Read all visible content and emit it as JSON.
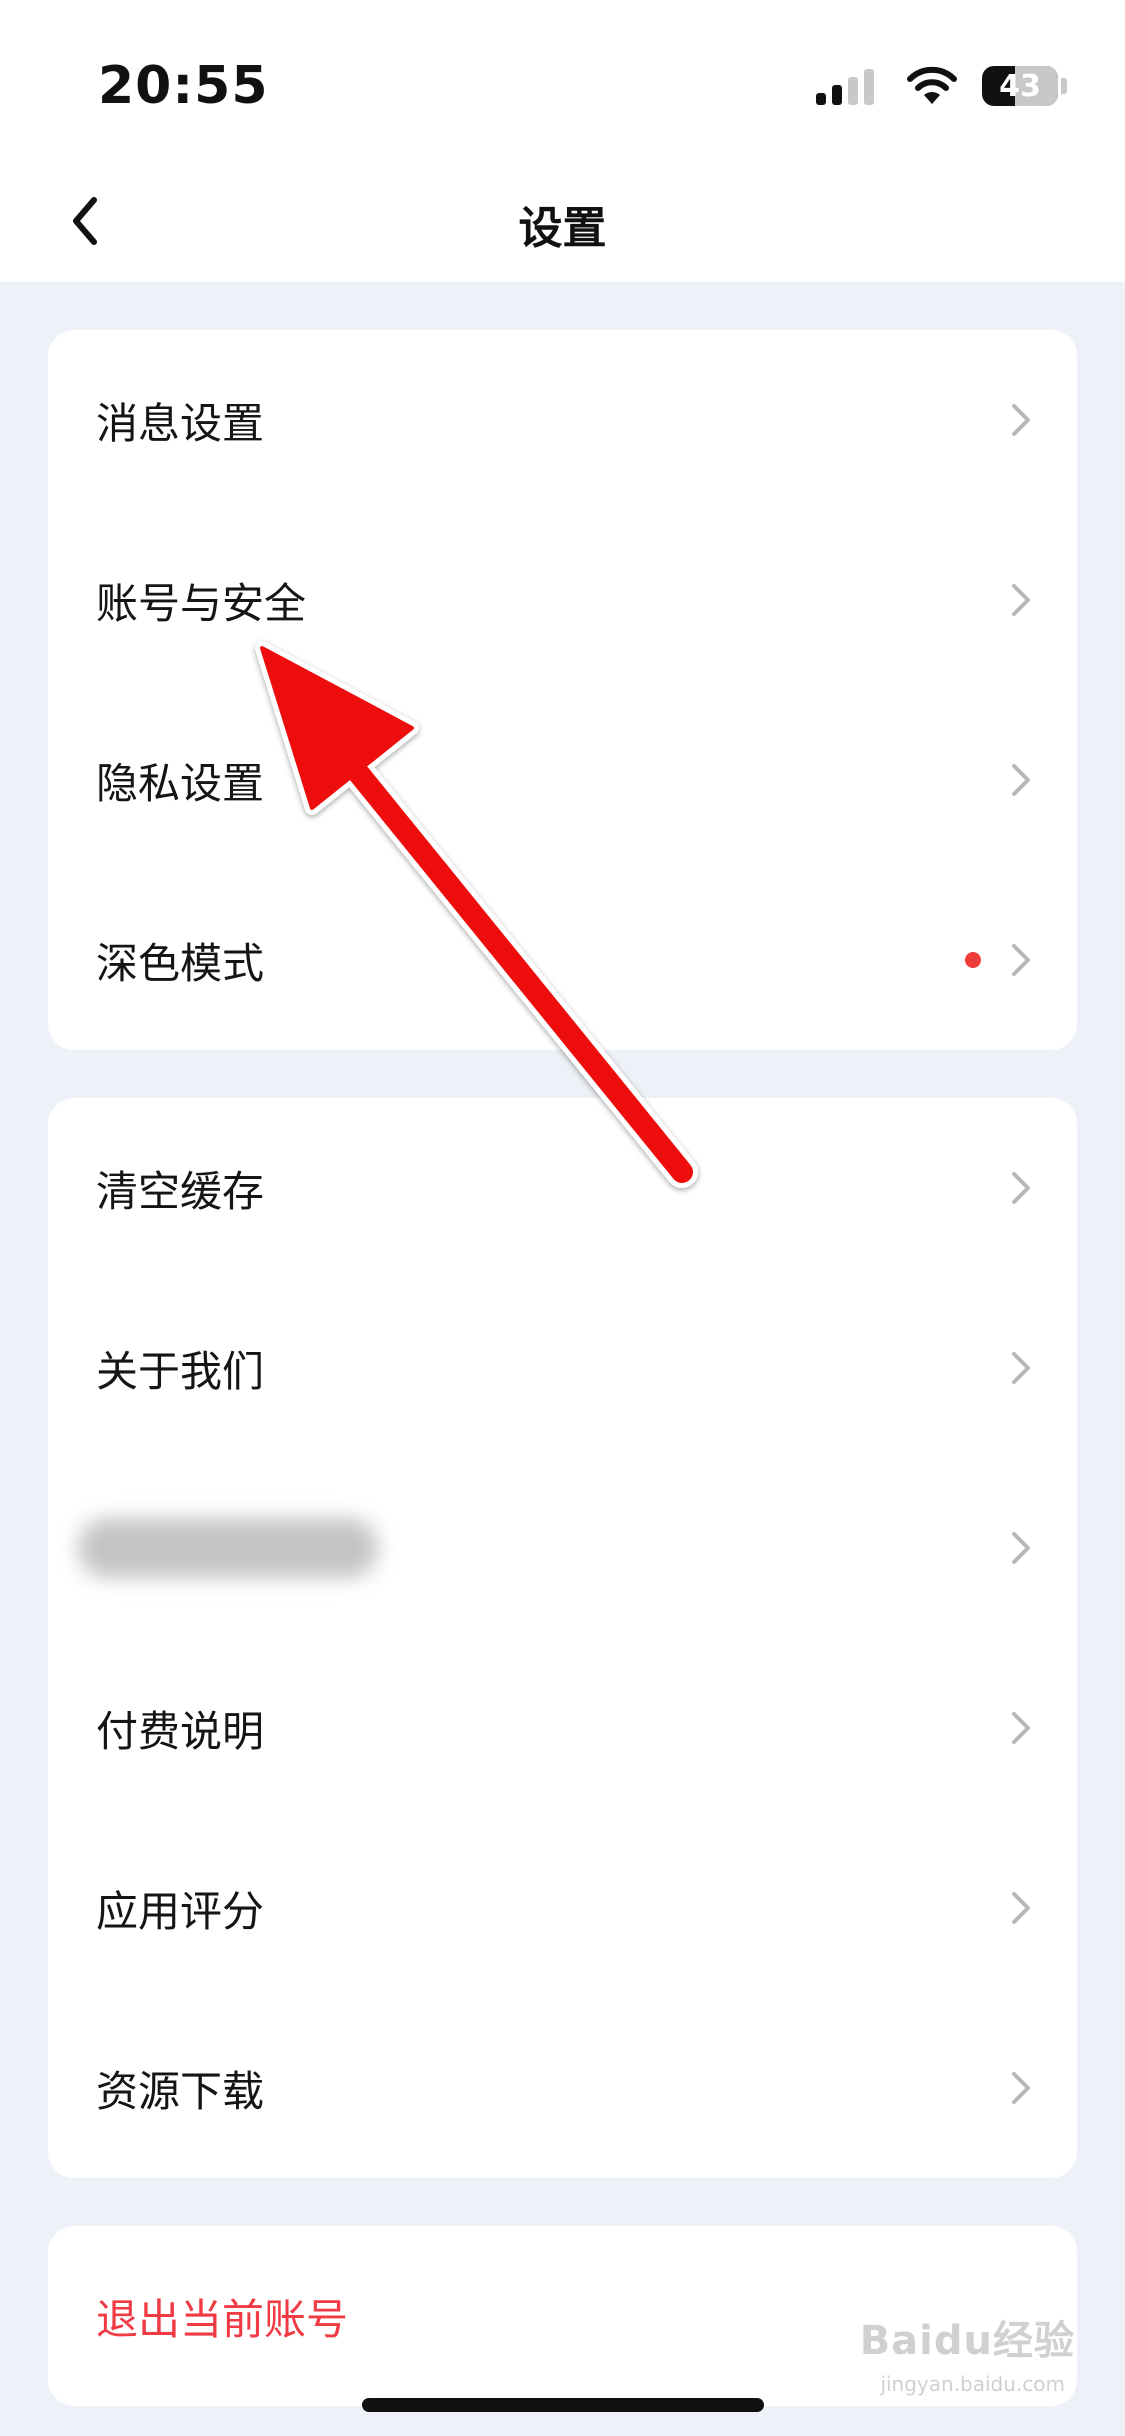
{
  "status_bar": {
    "time": "20:55",
    "battery_level": "43",
    "battery_fraction": 0.43
  },
  "nav": {
    "title": "设置",
    "back_icon": "chevron-left-icon"
  },
  "groups": [
    {
      "items": [
        {
          "label": "消息设置"
        },
        {
          "label": "账号与安全"
        },
        {
          "label": "隐私设置"
        },
        {
          "label": "深色模式",
          "badge": "red-dot"
        }
      ]
    },
    {
      "items": [
        {
          "label": "清空缓存"
        },
        {
          "label": "关于我们"
        },
        {
          "label": ""
        },
        {
          "label": "付费说明"
        },
        {
          "label": "应用评分"
        },
        {
          "label": "资源下载"
        }
      ]
    }
  ],
  "logout": {
    "label": "退出当前账号"
  },
  "watermark": {
    "text": "Baidu经验",
    "sub": "jingyan.baidu.com"
  },
  "colors": {
    "background": "#eef1f7",
    "card": "#ffffff",
    "danger": "#f03a44",
    "badge": "#ee3b3b",
    "annotation_arrow": "#ee1111"
  }
}
